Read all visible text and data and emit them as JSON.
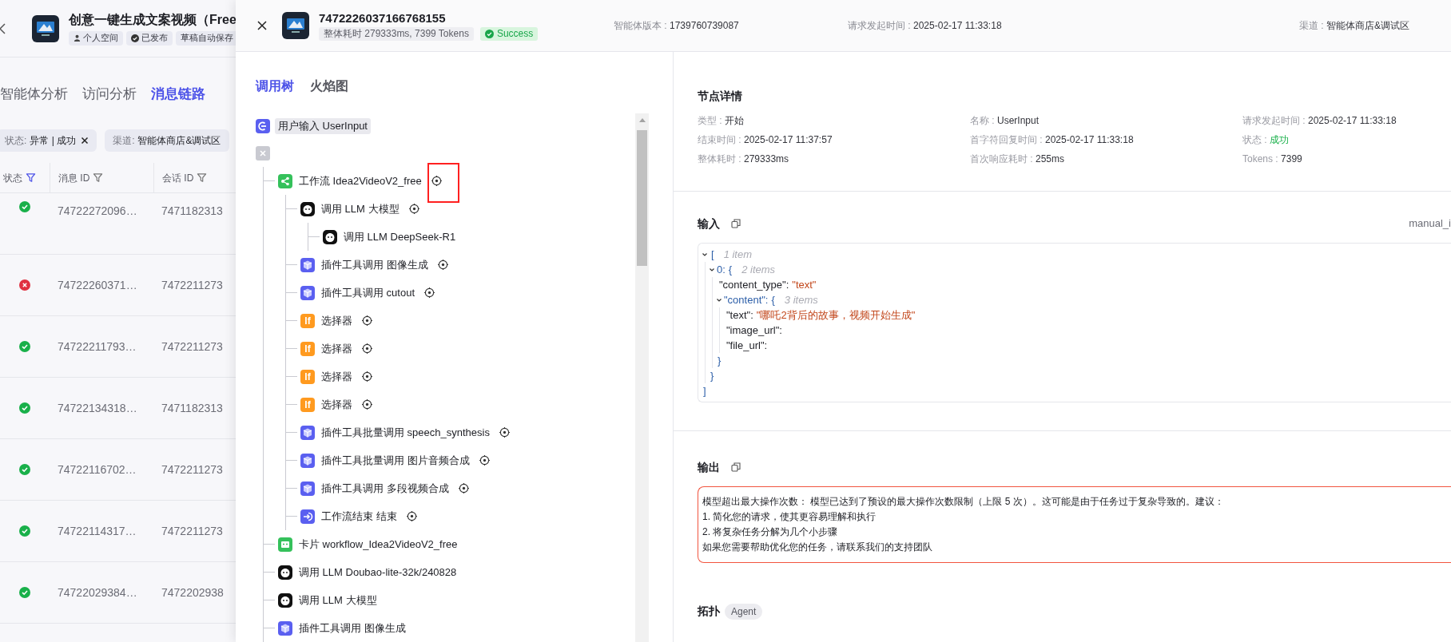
{
  "background_page": {
    "title": "创意一键生成文案视频（Free",
    "tags": [
      {
        "kind": "space",
        "label": "个人空间"
      },
      {
        "kind": "published",
        "label": "已发布"
      },
      {
        "kind": "plain",
        "label": "草稿自动保存"
      }
    ],
    "tabs": [
      {
        "label": "智能体分析",
        "selected": false
      },
      {
        "label": "访问分析",
        "selected": false
      },
      {
        "label": "消息链路",
        "selected": true
      }
    ],
    "filters": [
      {
        "label": "状态:",
        "value": "异常 | 成功",
        "removable": true
      },
      {
        "label": "渠道:",
        "value": "智能体商店&调试区",
        "removable": false
      }
    ],
    "table": {
      "columns": [
        {
          "label": "状态",
          "filtered": true
        },
        {
          "label": "消息 ID",
          "filtered": false
        },
        {
          "label": "会话 ID",
          "filtered": false
        }
      ],
      "rows": [
        {
          "kind": "success",
          "message_id": "74722272096…",
          "session_id": "7471182313"
        },
        {
          "kind": "error",
          "message_id": "74722260371…",
          "session_id": "7472211273"
        },
        {
          "kind": "success",
          "message_id": "74722211793…",
          "session_id": "7472211273"
        },
        {
          "kind": "success",
          "message_id": "74722134318…",
          "session_id": "7471182313"
        },
        {
          "kind": "success",
          "message_id": "74722116702…",
          "session_id": "7472211273"
        },
        {
          "kind": "success",
          "message_id": "74722114317…",
          "session_id": "7472211273"
        },
        {
          "kind": "success",
          "message_id": "74722029384…",
          "session_id": "7472202938"
        }
      ]
    }
  },
  "drawer": {
    "header": {
      "message_id": "7472226037166768155",
      "summary": "整体耗时 279333ms, 7399 Tokens",
      "status": {
        "kind": "success",
        "label": "Success"
      },
      "meta": [
        {
          "label": "智能体版本 :",
          "value": "1739760739087"
        },
        {
          "label": "请求发起时间 :",
          "value": "2025-02-17 11:33:18"
        },
        {
          "label": "渠道 :",
          "value": "智能体商店&调试区"
        }
      ]
    },
    "tree_tabs": [
      {
        "label": "调用树",
        "selected": true
      },
      {
        "label": "火焰图",
        "selected": false
      }
    ],
    "call_tree": {
      "kind": "userinput",
      "label": "用户输入 UserInput",
      "selected": true,
      "expanded": true,
      "children": [
        {
          "kind": "workflow",
          "label": "工作流 Idea2VideoV2_free",
          "selected": false,
          "locate": true,
          "annotated": true,
          "children": [
            {
              "kind": "llm",
              "label": "调用 LLM 大模型",
              "selected": false,
              "locate": true,
              "children": [
                {
                  "kind": "llm",
                  "label": "调用 LLM DeepSeek-R1",
                  "selected": false,
                  "locate": false
                }
              ]
            },
            {
              "kind": "plugin",
              "label": "插件工具调用 图像生成",
              "selected": false,
              "locate": true
            },
            {
              "kind": "plugin",
              "label": "插件工具调用 cutout",
              "selected": false,
              "locate": true
            },
            {
              "kind": "selector",
              "icon_text": "If",
              "label": "选择器",
              "selected": false,
              "locate": true
            },
            {
              "kind": "selector",
              "icon_text": "If",
              "label": "选择器",
              "selected": false,
              "locate": true
            },
            {
              "kind": "selector",
              "icon_text": "If",
              "label": "选择器",
              "selected": false,
              "locate": true
            },
            {
              "kind": "selector",
              "icon_text": "If",
              "label": "选择器",
              "selected": false,
              "locate": true
            },
            {
              "kind": "plugin",
              "label": "插件工具批量调用 speech_synthesis",
              "selected": false,
              "locate": true
            },
            {
              "kind": "plugin",
              "label": "插件工具批量调用 图片音频合成",
              "selected": false,
              "locate": true
            },
            {
              "kind": "plugin",
              "label": "插件工具调用 多段视频合成",
              "selected": false,
              "locate": true
            },
            {
              "kind": "end",
              "label": "工作流结束 结束",
              "selected": false,
              "locate": true
            }
          ]
        },
        {
          "kind": "card",
          "label": "卡片 workflow_Idea2VideoV2_free",
          "selected": false,
          "locate": false
        },
        {
          "kind": "llm",
          "label": "调用 LLM Doubao-lite-32k/240828",
          "selected": false,
          "locate": false
        },
        {
          "kind": "llm",
          "label": "调用 LLM 大模型",
          "selected": false,
          "locate": false
        },
        {
          "kind": "plugin",
          "label": "插件工具调用 图像生成",
          "selected": false,
          "locate": false
        }
      ]
    },
    "node_details": {
      "title": "节点详情",
      "fields": [
        {
          "label": "类型 :",
          "value": "开始",
          "kind": "plain"
        },
        {
          "label": "名称 :",
          "value": "UserInput",
          "kind": "plain"
        },
        {
          "label": "请求发起时间 :",
          "value": "2025-02-17 11:33:18",
          "kind": "plain"
        },
        {
          "label": "结束时间 :",
          "value": "2025-02-17 11:37:57",
          "kind": "plain"
        },
        {
          "label": "首字符回复时间 :",
          "value": "2025-02-17 11:33:18",
          "kind": "plain"
        },
        {
          "label": "状态 :",
          "value": "成功",
          "kind": "success"
        },
        {
          "label": "整体耗时 :",
          "value": "279333ms",
          "kind": "plain"
        },
        {
          "label": "首次响应耗时 :",
          "value": "255ms",
          "kind": "plain"
        },
        {
          "label": "Tokens :",
          "value": "7399",
          "kind": "plain"
        }
      ]
    },
    "input": {
      "title": "输入",
      "source": "manual_i",
      "json": {
        "open": "[",
        "count": "1 item",
        "expanded": true,
        "close": "]",
        "children": [
          {
            "key": "0:",
            "open": "{",
            "count": "2 items",
            "expanded": true,
            "close": "}",
            "children": [
              {
                "key": "\"content_type\":",
                "value": "\"text\""
              },
              {
                "key": "\"content\":",
                "open": "{",
                "count": "3 items",
                "expanded": true,
                "close": "}",
                "children": [
                  {
                    "key": "\"text\":",
                    "value": "\"哪吒2背后的故事，视频开始生成\""
                  },
                  {
                    "key": "\"image_url\":"
                  },
                  {
                    "key": "\"file_url\":"
                  }
                ]
              }
            ]
          }
        ]
      }
    },
    "output": {
      "title": "输出",
      "error": true,
      "lines": [
        "模型超出最大操作次数： 模型已达到了预设的最大操作次数限制（上限 5 次）。这可能是由于任务过于复杂导致的。建议：",
        "1. 简化您的请求，使其更容易理解和执行",
        "2. 将复杂任务分解为几个小步骤",
        "如果您需要帮助优化您的任务，请联系我们的支持团队"
      ]
    },
    "topology": {
      "title": "拓扑",
      "badge": "Agent"
    }
  }
}
